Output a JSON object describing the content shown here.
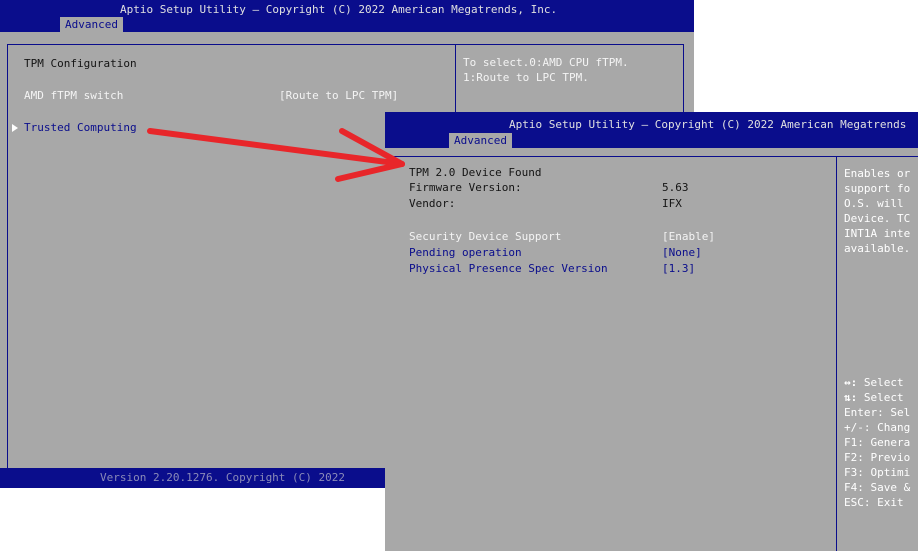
{
  "back_screen": {
    "title": "Aptio Setup Utility – Copyright (C) 2022 American Megatrends, Inc.",
    "tab": "Advanced",
    "heading": "TPM Configuration",
    "items": [
      {
        "label": "AMD fTPM switch",
        "value": "[Route to LPC TPM]"
      },
      {
        "label": "Trusted Computing",
        "value": ""
      }
    ],
    "help": [
      "To select.0:AMD CPU fTPM.",
      "1:Route to LPC TPM."
    ],
    "footer": "Version 2.20.1276. Copyright (C) 2022"
  },
  "front_screen": {
    "title": "Aptio Setup Utility – Copyright (C) 2022 American Megatrends",
    "tab": "Advanced",
    "info": [
      {
        "label": "TPM 2.0 Device Found",
        "value": ""
      },
      {
        "label": "Firmware Version:",
        "value": "5.63"
      },
      {
        "label": "Vendor:",
        "value": "IFX"
      }
    ],
    "options": [
      {
        "label": "Security Device Support",
        "value": "[Enable]"
      },
      {
        "label": "Pending operation",
        "value": "[None]"
      },
      {
        "label": "Physical Presence Spec Version",
        "value": "[1.3]"
      }
    ],
    "help": [
      "Enables or",
      "support fo",
      "O.S. will",
      "Device. TC",
      "INT1A inte",
      "available."
    ],
    "keys": [
      {
        "key": "↔:",
        "desc": " Select"
      },
      {
        "key": "⇅:",
        "desc": " Select"
      },
      {
        "key": "Enter:",
        "desc": " Sel"
      },
      {
        "key": "+/-:",
        "desc": " Chang"
      },
      {
        "key": "F1:",
        "desc": " Genera"
      },
      {
        "key": "F2:",
        "desc": " Previo"
      },
      {
        "key": "F3:",
        "desc": " Optimi"
      },
      {
        "key": "F4:",
        "desc": " Save &"
      },
      {
        "key": "ESC:",
        "desc": " Exit"
      }
    ]
  },
  "colors": {
    "bios_blue": "#0a0d8c",
    "bios_gray": "#a8a8a8",
    "arrow_red": "#e8262a"
  }
}
